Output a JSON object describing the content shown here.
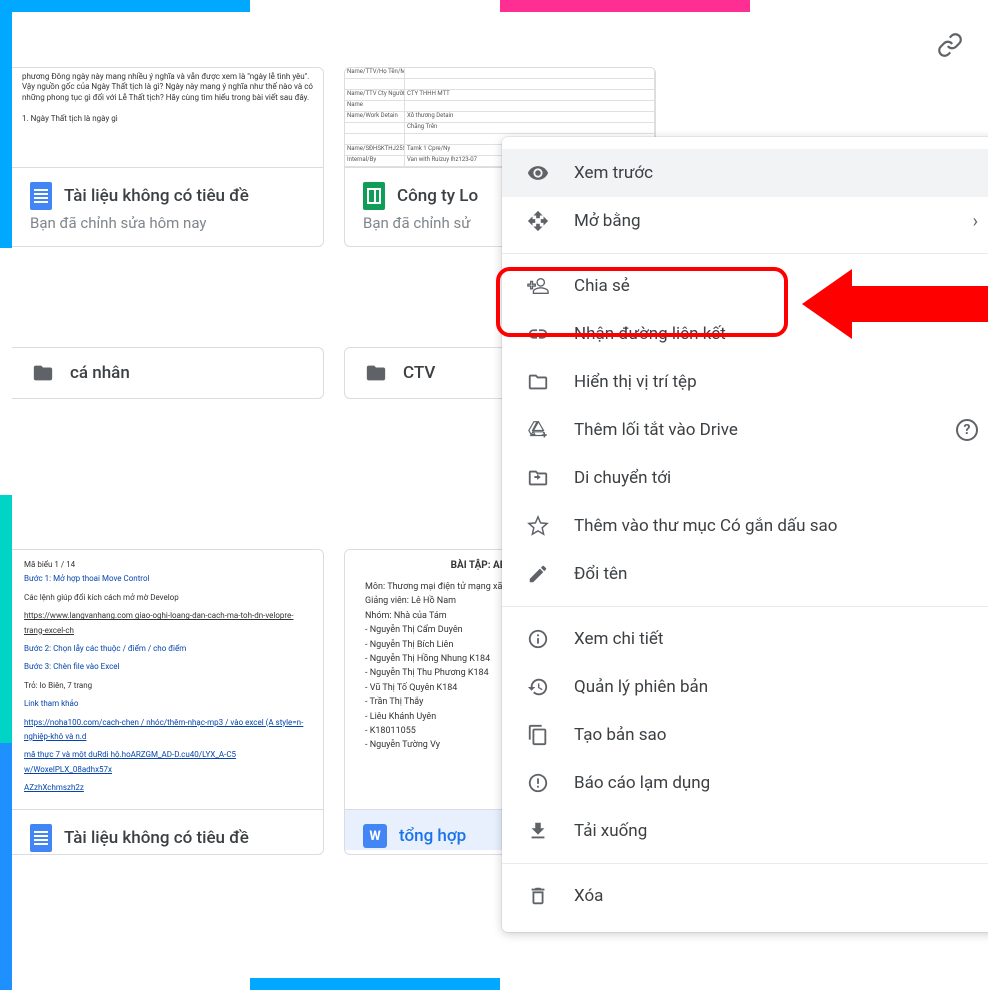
{
  "header": {
    "link_icon": "link-icon"
  },
  "files": {
    "row1": [
      {
        "title": "Tài liệu không có tiêu đề",
        "subtitle": "Bạn đã chỉnh sửa hôm nay",
        "type": "doc"
      },
      {
        "title": "Công ty Lo",
        "subtitle": "Bạn đã chỉnh sử",
        "type": "sheet"
      }
    ],
    "folders": [
      {
        "label": "cá nhân"
      },
      {
        "label": "CTV"
      }
    ],
    "row3": [
      {
        "title": "Tài liệu không có tiêu đề",
        "type": "doc"
      },
      {
        "title": "tổng hợp",
        "type": "word"
      }
    ]
  },
  "thumb_text_1": "phương Đông ngày này mang nhiều ý nghĩa và vẫn được xem là \"ngày lễ tình yêu\". Vậy nguồn gốc của Ngày Thất tịch là gì? Ngày này mang ý nghĩa như thế nào và có những phong tục gì đối với Lễ Thất tịch? Hãy cùng tìm hiểu trong bài viết sau đây.\n\n1. Ngày Thất tịch là ngày gì",
  "thumb_text_2": {
    "header": "Mã biểu 1 / 14",
    "lines": [
      "Bước 1: Mở hợp thoai Move Control",
      "Các lệnh giúp đổi kích cách mở mờ Develop",
      "https://www.langvanhang.com giao-oghi-loang-dan-cach-ma-toh-dn-velopre-trang-excel-ch",
      "Bước 2: Chọn lẫy các thuộc / điểm / cho điểm",
      "Bước 3: Chèn file vào Excel",
      "Trỏ: lo Biên, 7 trang",
      "Link tham khảo",
      "https://noha100.com/cach-chen / nhóc/thêm-nhạc-mp3 / vào excel (A style=n-nghiệp-khô và n.d",
      "mã thực 7 và một duRdi hộ.hoARZGM_AD-D.cu40/LYX_A-C5 w/WoxelPLX_08adhx57x",
      "AZzhXchmszh2z"
    ]
  },
  "thumb_text_3": {
    "title": "BÀI TẬP: AB TESTING",
    "lines": [
      "Môn: Thương mại điện tử mạng xã hội",
      "Giảng viên: Lê Hồ Nam",
      "Nhóm: Nhà của Tám",
      "- Nguyễn Thị Cẩm Duyên",
      "- Nguyễn Thị Bích Liên",
      "- Nguyễn Thị Hồng Nhung   K184",
      "- Nguyễn Thị Thu Phương   K184",
      "- Vũ Thị Tố Quyên   K184",
      "- Trần Thị Thắy",
      "- Liêu Khánh Uyên",
      "- K18011055",
      "- Nguyễn Tường Vy"
    ]
  },
  "context_menu": {
    "items": [
      {
        "key": "preview",
        "label": "Xem trước",
        "icon": "eye",
        "hovered": true
      },
      {
        "key": "open_with",
        "label": "Mở bằng",
        "icon": "move-arrows",
        "chevron": true
      },
      {
        "sep": true
      },
      {
        "key": "share",
        "label": "Chia sẻ",
        "icon": "person-add",
        "highlighted": true
      },
      {
        "key": "get_link",
        "label": "Nhận đường liên kết",
        "icon": "link"
      },
      {
        "key": "show_location",
        "label": "Hiển thị vị trí tệp",
        "icon": "folder-outline"
      },
      {
        "key": "add_shortcut",
        "label": "Thêm lối tắt vào Drive",
        "icon": "drive-add",
        "help": true
      },
      {
        "key": "move_to",
        "label": "Di chuyển tới",
        "icon": "folder-move"
      },
      {
        "key": "add_starred",
        "label": "Thêm vào thư mục Có gắn dấu sao",
        "icon": "star"
      },
      {
        "key": "rename",
        "label": "Đổi tên",
        "icon": "pencil"
      },
      {
        "sep": true
      },
      {
        "key": "details",
        "label": "Xem chi tiết",
        "icon": "info"
      },
      {
        "key": "versions",
        "label": "Quản lý phiên bản",
        "icon": "history"
      },
      {
        "key": "make_copy",
        "label": "Tạo bản sao",
        "icon": "copy"
      },
      {
        "key": "report_abuse",
        "label": "Báo cáo lạm dụng",
        "icon": "alert"
      },
      {
        "key": "download",
        "label": "Tải xuống",
        "icon": "download"
      },
      {
        "sep": true
      },
      {
        "key": "delete",
        "label": "Xóa",
        "icon": "trash"
      }
    ]
  }
}
